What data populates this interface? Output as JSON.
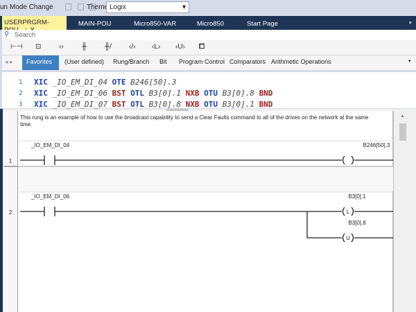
{
  "toolbar": {
    "run_mode_label": "un Mode Change",
    "theme_label": "Theme:",
    "theme_value": "Logix"
  },
  "tabs": [
    {
      "label": "USERPRGRM-POU",
      "active": true
    },
    {
      "label": "MAIN-POU"
    },
    {
      "label": "Micro850-VAR"
    },
    {
      "label": "Micro850"
    },
    {
      "label": "Start Page"
    }
  ],
  "search": {
    "placeholder": "Search"
  },
  "instruction_icons": [
    "branch-icon",
    "rung-icon",
    "coil-icon",
    "contact-no-icon",
    "contact-nc-icon",
    "coil-negated-icon",
    "coil-latch-icon",
    "coil-unlatch-icon",
    "block-icon"
  ],
  "categories": {
    "items": [
      "Favorites",
      "(User defined)",
      "Rung/Branch",
      "Bit",
      "Program Control",
      "Comparators",
      "Arithmetic Operations"
    ],
    "selected": "Favorites"
  },
  "code": {
    "lines": [
      {
        "num": "1",
        "tokens": [
          [
            "XIC",
            "k"
          ],
          [
            " _IO_EM_DI_04 ",
            "v"
          ],
          [
            "OTE",
            "k"
          ],
          [
            " B246[50].3",
            "v"
          ]
        ]
      },
      {
        "num": "2",
        "tokens": [
          [
            "XIC",
            "k"
          ],
          [
            " _IO_EM_DI_06 ",
            "v"
          ],
          [
            "BST",
            "r"
          ],
          [
            " ",
            ""
          ],
          [
            "OTL",
            "k"
          ],
          [
            " B3[0].1 ",
            "v"
          ],
          [
            "NXB",
            "r"
          ],
          [
            " ",
            ""
          ],
          [
            "OTU",
            "k"
          ],
          [
            " B3[0].8 ",
            "v"
          ],
          [
            "BND",
            "r"
          ]
        ]
      },
      {
        "num": "3",
        "tokens": [
          [
            "XIC",
            "k"
          ],
          [
            " _IO_EM_DI_07 ",
            "v"
          ],
          [
            "BST",
            "r"
          ],
          [
            " ",
            ""
          ],
          [
            "OTL",
            "k"
          ],
          [
            " B3[0].8 ",
            "v"
          ],
          [
            "NXB",
            "r"
          ],
          [
            " ",
            ""
          ],
          [
            "OTU",
            "k"
          ],
          [
            " B3[0].1 ",
            "v"
          ],
          [
            "BND",
            "r"
          ]
        ]
      }
    ]
  },
  "ladder": {
    "comment": "This rung is an example of how to use the broadcast capability to send a Clear Faults command to all of the drives on the network at the same time.",
    "rungs": [
      {
        "number": "1",
        "contact": "_IO_EM_DI_04",
        "coils": [
          {
            "tag": "B246[50].3",
            "type": ""
          }
        ]
      },
      {
        "number": "2",
        "contact": "_IO_EM_DI_06",
        "coils": [
          {
            "tag": "B3[0].1",
            "type": "L"
          },
          {
            "tag": "B3[0].8",
            "type": "U"
          }
        ]
      }
    ]
  }
}
